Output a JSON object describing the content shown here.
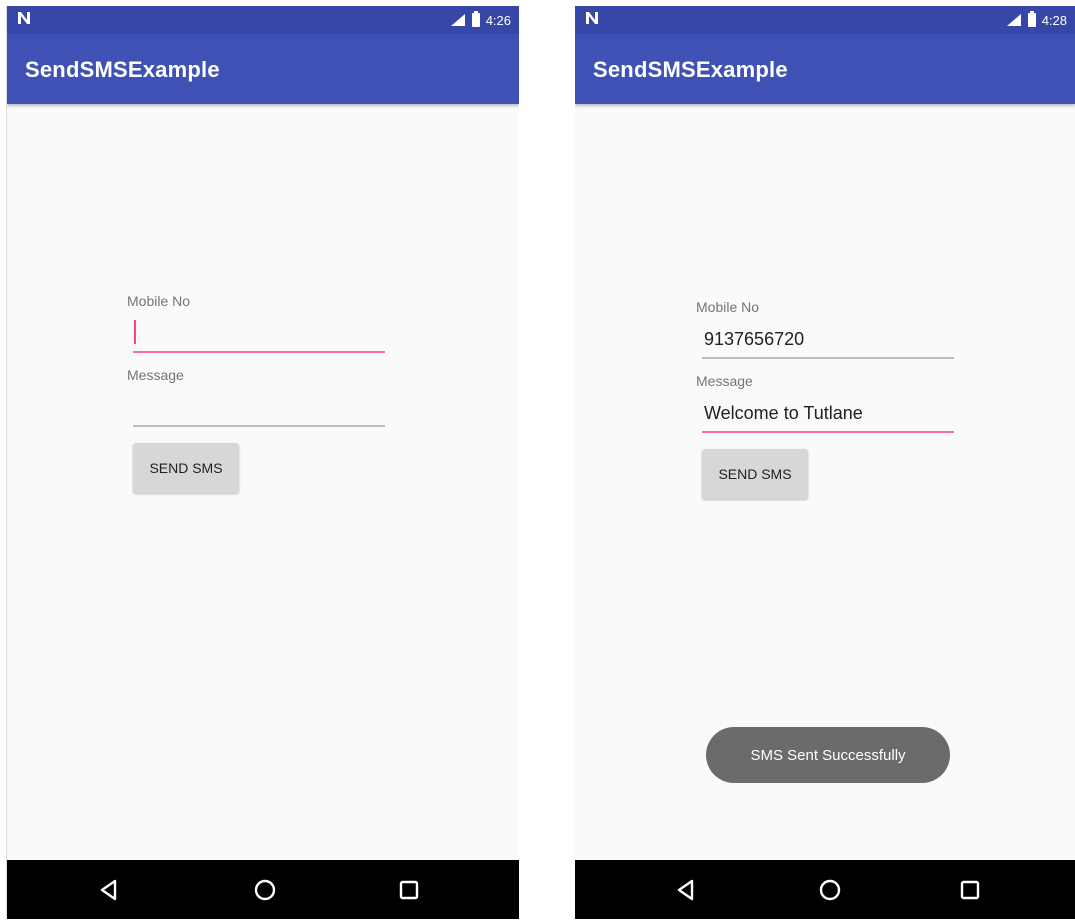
{
  "screens": [
    {
      "status": {
        "time": "4:26"
      },
      "app_title": "SendSMSExample",
      "form": {
        "mobile_label": "Mobile No",
        "mobile_value": "",
        "message_label": "Message",
        "message_value": "",
        "send_label": "SEND SMS"
      }
    },
    {
      "status": {
        "time": "4:28"
      },
      "app_title": "SendSMSExample",
      "form": {
        "mobile_label": "Mobile No",
        "mobile_value": "9137656720",
        "message_label": "Message",
        "message_value": "Welcome to Tutlane",
        "send_label": "SEND SMS"
      },
      "toast": "SMS Sent Successfully"
    }
  ],
  "colors": {
    "primary": "#3f51b5",
    "primary_dark": "#3647a8",
    "accent": "#ff4081",
    "nav_bar": "#000000"
  },
  "icons": {
    "status_left": "n-notification-icon",
    "signal": "signal-icon",
    "battery": "battery-icon",
    "nav": [
      "back-icon",
      "home-icon",
      "recent-apps-icon"
    ]
  }
}
